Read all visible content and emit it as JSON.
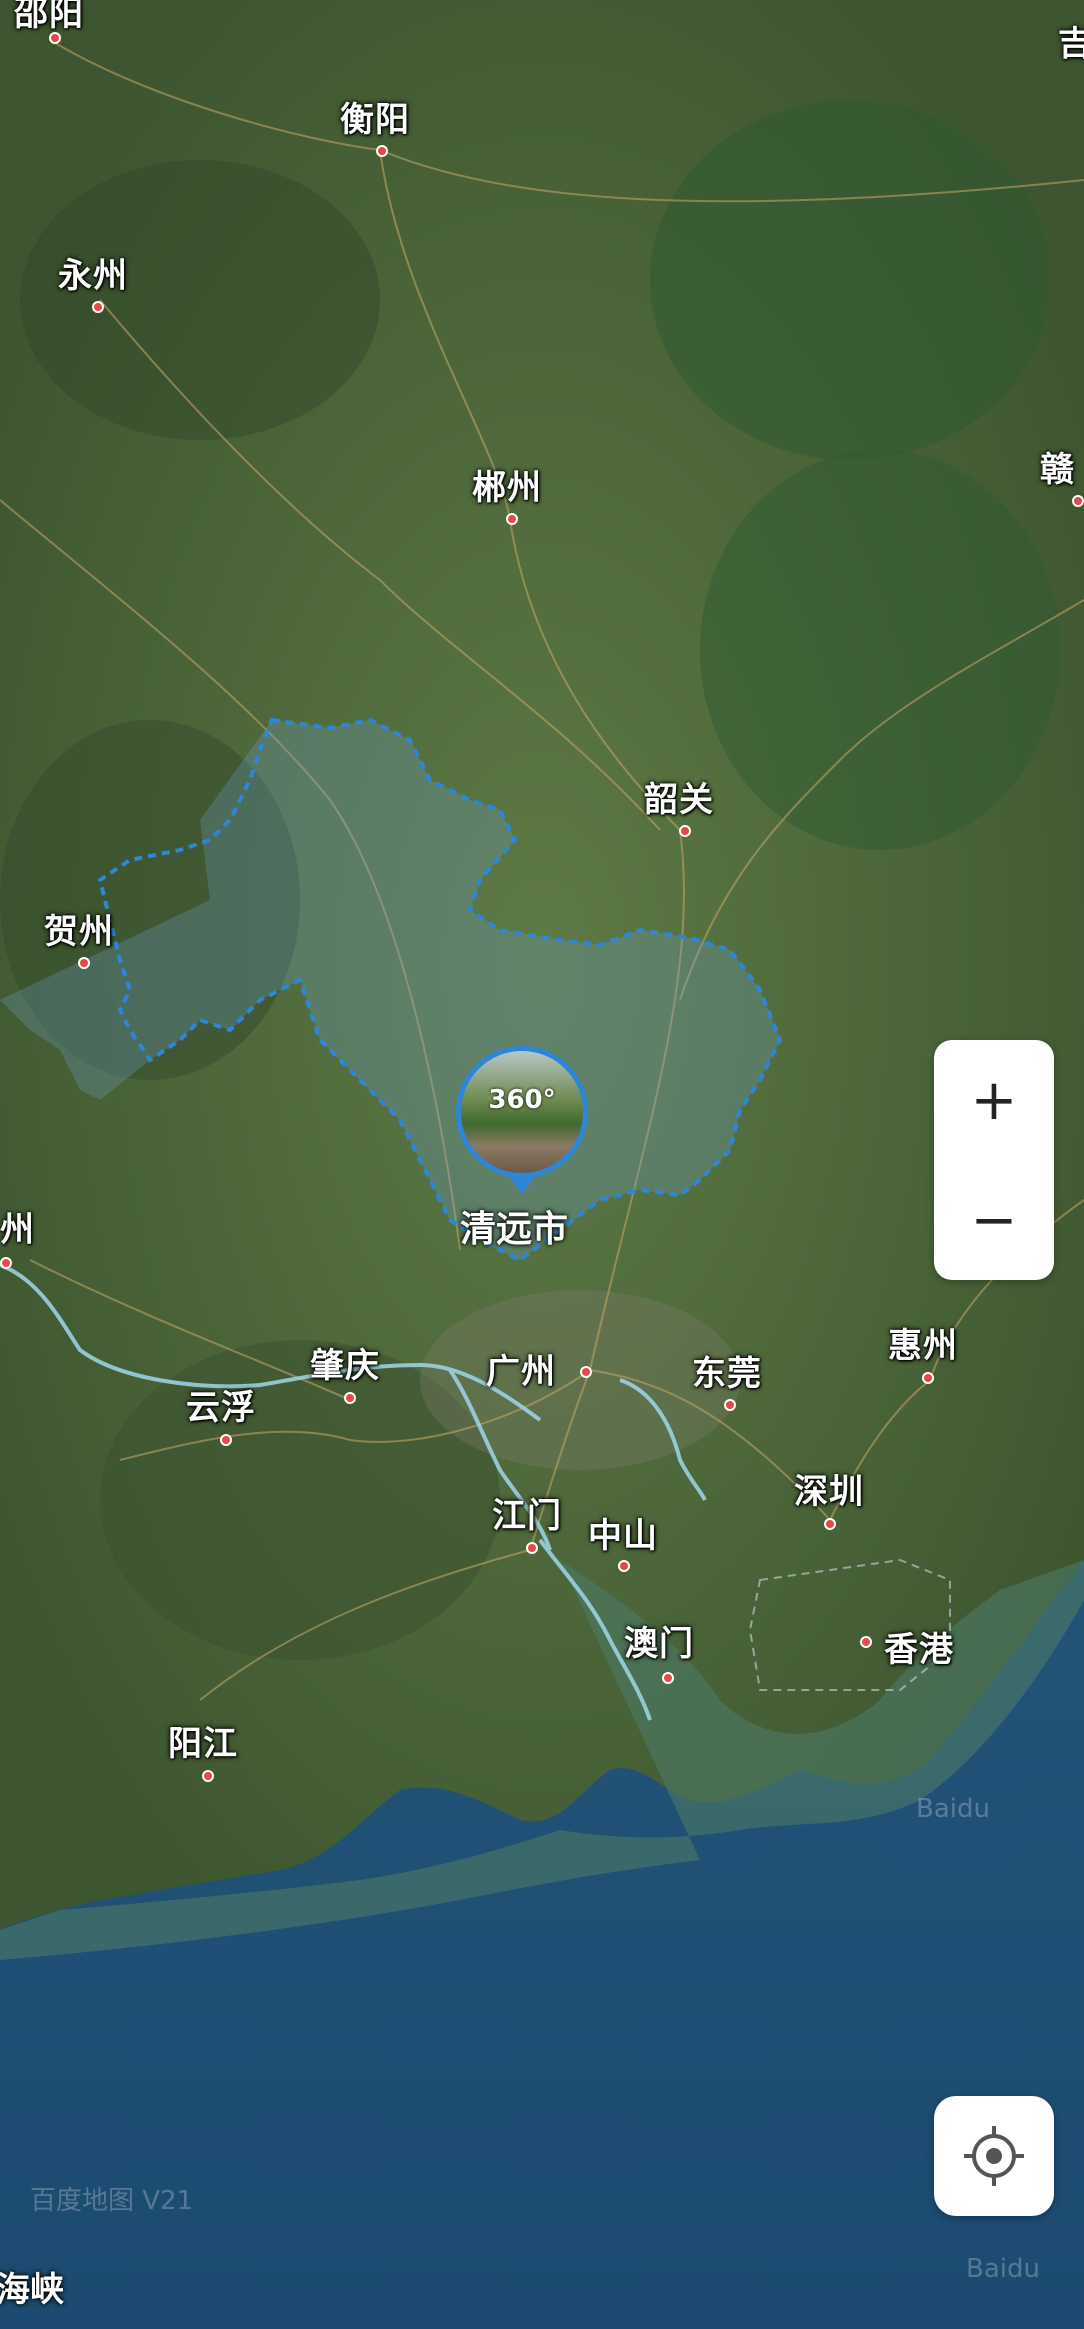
{
  "cities": [
    {
      "id": "shaoyang",
      "name": "邵阳"
    },
    {
      "id": "hengyang",
      "name": "衡阳"
    },
    {
      "id": "yongzhou",
      "name": "永州"
    },
    {
      "id": "chenzhou",
      "name": "郴州"
    },
    {
      "id": "ganzhou",
      "name": "赣"
    },
    {
      "id": "ji",
      "name": "吉"
    },
    {
      "id": "shaoguan",
      "name": "韶关"
    },
    {
      "id": "hezhou",
      "name": "贺州"
    },
    {
      "id": "wuzhou",
      "name": "州"
    },
    {
      "id": "guangzhou",
      "name": "广州"
    },
    {
      "id": "dongguan",
      "name": "东莞"
    },
    {
      "id": "huizhou",
      "name": "惠州"
    },
    {
      "id": "zhaoqing",
      "name": "肇庆"
    },
    {
      "id": "yunfu",
      "name": "云浮"
    },
    {
      "id": "shenzhen",
      "name": "深圳"
    },
    {
      "id": "jiangmen",
      "name": "江门"
    },
    {
      "id": "zhongshan",
      "name": "中山"
    },
    {
      "id": "macau",
      "name": "澳门"
    },
    {
      "id": "hongkong",
      "name": "香港"
    },
    {
      "id": "yangjiang",
      "name": "阳江"
    }
  ],
  "highlight": {
    "name": "清远市",
    "pano_text": "360°"
  },
  "sea_label": "海峡",
  "controls": {
    "zoom_in": "+",
    "zoom_out": "−"
  },
  "watermarks": {
    "baidu1": "Baidu",
    "baidu2": "Baidu",
    "map_code": "百度地图 V21"
  },
  "colors": {
    "boundary": "#2e86d8",
    "city_dot": "#e84848",
    "land": "#4f6a3c",
    "sea": "#1d4d6d"
  }
}
